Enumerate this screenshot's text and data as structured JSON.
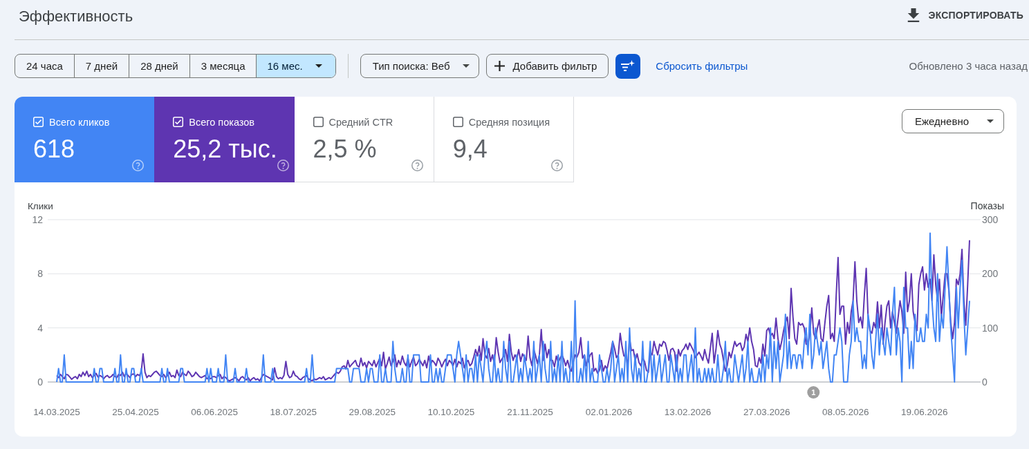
{
  "header": {
    "title": "Эффективность",
    "export_button": {
      "label": "ЭКСПОРТИРОВАТЬ"
    }
  },
  "filters": {
    "date_ranges": [
      {
        "label": "24 часа",
        "selected": false,
        "kind": "preset"
      },
      {
        "label": "7 дней",
        "selected": false,
        "kind": "preset"
      },
      {
        "label": "28 дней",
        "selected": false,
        "kind": "preset"
      },
      {
        "label": "3 месяца",
        "selected": false,
        "kind": "preset"
      },
      {
        "label": "16 мес.",
        "selected": true,
        "kind": "menu"
      }
    ],
    "search_type": {
      "label": "Тип поиска: Веб"
    },
    "add_filter": {
      "label": "Добавить фильтр"
    },
    "reset_link": {
      "label": "Сбросить фильтры"
    },
    "updated": "Обновлено 3 часа назад"
  },
  "metrics": [
    {
      "label": "Всего кликов",
      "value": "618",
      "checked": true,
      "color": "#4285f4"
    },
    {
      "label": "Всего показов",
      "value": "25,2 тыс.",
      "checked": true,
      "color": "#5e35b1"
    },
    {
      "label": "Средний CTR",
      "value": "2,5 %",
      "checked": false
    },
    {
      "label": "Средняя позиция",
      "value": "9,4",
      "checked": false
    }
  ],
  "granularity": {
    "value": "Ежедневно"
  },
  "chart": {
    "chart_data": {
      "type": "line",
      "ylabel": "Клики",
      "y2label": "Показы",
      "ylim": [
        0,
        12
      ],
      "yticks": [
        0,
        4,
        8,
        12
      ],
      "y2lim": [
        0,
        300
      ],
      "y2ticks": [
        0,
        100,
        200,
        300
      ],
      "categories": [
        "14.03.2025",
        null,
        null,
        null,
        null,
        null,
        null,
        null,
        null,
        null,
        null,
        null,
        null,
        null,
        null,
        null,
        null,
        null,
        null,
        null,
        null,
        null,
        null,
        null,
        null,
        null,
        null,
        null,
        null,
        null,
        null,
        null,
        null,
        null,
        null,
        null,
        null,
        null,
        null,
        null,
        null,
        null,
        "25.04.2025",
        null,
        null,
        null,
        null,
        null,
        null,
        null,
        null,
        null,
        null,
        null,
        null,
        null,
        null,
        null,
        null,
        null,
        null,
        null,
        null,
        null,
        null,
        null,
        null,
        null,
        null,
        null,
        null,
        null,
        null,
        null,
        null,
        null,
        null,
        null,
        null,
        null,
        null,
        null,
        null,
        null,
        "06.06.2025",
        null,
        null,
        null,
        null,
        null,
        null,
        null,
        null,
        null,
        null,
        null,
        null,
        null,
        null,
        null,
        null,
        null,
        null,
        null,
        null,
        null,
        null,
        null,
        null,
        null,
        null,
        null,
        null,
        null,
        null,
        null,
        null,
        null,
        null,
        null,
        null,
        null,
        null,
        null,
        null,
        null,
        "18.07.2025",
        null,
        null,
        null,
        null,
        null,
        null,
        null,
        null,
        null,
        null,
        null,
        null,
        null,
        null,
        null,
        null,
        null,
        null,
        null,
        null,
        null,
        null,
        null,
        null,
        null,
        null,
        null,
        null,
        null,
        null,
        null,
        null,
        null,
        null,
        null,
        null,
        null,
        null,
        null,
        null,
        null,
        "29.08.2025",
        null,
        null,
        null,
        null,
        null,
        null,
        null,
        null,
        null,
        null,
        null,
        null,
        null,
        null,
        null,
        null,
        null,
        null,
        null,
        null,
        null,
        null,
        null,
        null,
        null,
        null,
        null,
        null,
        null,
        null,
        null,
        null,
        null,
        null,
        null,
        null,
        null,
        null,
        null,
        null,
        null,
        "10.10.2025",
        null,
        null,
        null,
        null,
        null,
        null,
        null,
        null,
        null,
        null,
        null,
        null,
        null,
        null,
        null,
        null,
        null,
        null,
        null,
        null,
        null,
        null,
        null,
        null,
        null,
        null,
        null,
        null,
        null,
        null,
        null,
        null,
        null,
        null,
        null,
        null,
        null,
        null,
        null,
        null,
        null,
        "21.11.2025",
        null,
        null,
        null,
        null,
        null,
        null,
        null,
        null,
        null,
        null,
        null,
        null,
        null,
        null,
        null,
        null,
        null,
        null,
        null,
        null,
        null,
        null,
        null,
        null,
        null,
        null,
        null,
        null,
        null,
        null,
        null,
        null,
        null,
        null,
        null,
        null,
        null,
        null,
        null,
        null,
        null,
        "02.01.2026",
        null,
        null,
        null,
        null,
        null,
        null,
        null,
        null,
        null,
        null,
        null,
        null,
        null,
        null,
        null,
        null,
        null,
        null,
        null,
        null,
        null,
        null,
        null,
        null,
        null,
        null,
        null,
        null,
        null,
        null,
        null,
        null,
        null,
        null,
        null,
        null,
        null,
        null,
        null,
        null,
        null,
        "13.02.2026",
        null,
        null,
        null,
        null,
        null,
        null,
        null,
        null,
        null,
        null,
        null,
        null,
        null,
        null,
        null,
        null,
        null,
        null,
        null,
        null,
        null,
        null,
        null,
        null,
        null,
        null,
        null,
        null,
        null,
        null,
        null,
        null,
        null,
        null,
        null,
        null,
        null,
        null,
        null,
        null,
        null,
        "27.03.2026",
        null,
        null,
        null,
        null,
        null,
        null,
        null,
        null,
        null,
        null,
        null,
        null,
        null,
        null,
        null,
        null,
        null,
        null,
        null,
        null,
        null,
        null,
        null,
        null,
        null,
        null,
        null,
        null,
        null,
        null,
        null,
        null,
        null,
        null,
        null,
        null,
        null,
        null,
        null,
        null,
        null,
        "08.05.2026",
        null,
        null,
        null,
        null,
        null,
        null,
        null,
        null,
        null,
        null,
        null,
        null,
        null,
        null,
        null,
        null,
        null,
        null,
        null,
        null,
        null,
        null,
        null,
        null,
        null,
        null,
        null,
        null,
        null,
        null,
        null,
        null,
        null,
        null,
        null,
        null,
        null,
        null,
        null,
        null,
        null,
        "19.06.2026",
        null,
        null,
        null,
        null,
        null,
        null,
        null,
        null,
        null,
        null,
        null,
        null,
        null,
        null,
        null,
        null,
        null,
        null,
        null,
        null,
        null,
        null,
        null,
        null
      ],
      "annotations": [
        "1"
      ],
      "series": [
        {
          "color": "#4285f4",
          "values": [
            0,
            1,
            0,
            0,
            2,
            0,
            0,
            0,
            0,
            0,
            0,
            0,
            0,
            0,
            0,
            0,
            0,
            0,
            0,
            0,
            1,
            0,
            0,
            1,
            1,
            0,
            0,
            0,
            0,
            0,
            0,
            1,
            0,
            0,
            2,
            0,
            0,
            1,
            0,
            0,
            1,
            1,
            0,
            0,
            0,
            1,
            0,
            0,
            0,
            0,
            0,
            0,
            0,
            0,
            0,
            0,
            1,
            0,
            0,
            1,
            0,
            0,
            0,
            0,
            0,
            0,
            1,
            1,
            0,
            0,
            0,
            0,
            0,
            0,
            0,
            0,
            0,
            0,
            0,
            0,
            1,
            0,
            1,
            0,
            0,
            0,
            1,
            0,
            0,
            0,
            2,
            0,
            0,
            0,
            0,
            1,
            0,
            0,
            0,
            0,
            0,
            1,
            0,
            0,
            0,
            0,
            0,
            0,
            0,
            0,
            2,
            0,
            0,
            0,
            0,
            1,
            0,
            0,
            0,
            0,
            0,
            0,
            0,
            0,
            0,
            0,
            0,
            0,
            0,
            0,
            0,
            0,
            0,
            1,
            0,
            0,
            2,
            0,
            0,
            0,
            0,
            0,
            0,
            0,
            0,
            0,
            0,
            0,
            0,
            1,
            1,
            1,
            1,
            1,
            1,
            1,
            0,
            0,
            1,
            1,
            1,
            1,
            0,
            0,
            0,
            1,
            0,
            1,
            1,
            0,
            0,
            0,
            2,
            0,
            0,
            1,
            0,
            0,
            0,
            3,
            1,
            0,
            0,
            0,
            1,
            0,
            0,
            2,
            0,
            0,
            2,
            2,
            2,
            2,
            0,
            0,
            0,
            0,
            0,
            2,
            0,
            0,
            1,
            0,
            1,
            0,
            0,
            1,
            2,
            2,
            2,
            1,
            0,
            2,
            3,
            2,
            1,
            0,
            2,
            0,
            1,
            1,
            0,
            2,
            0,
            2,
            1,
            0,
            2,
            3,
            1,
            0,
            0,
            2,
            0,
            1,
            0,
            0,
            3,
            1,
            0,
            3,
            0,
            0,
            1,
            2,
            0,
            1,
            0,
            2,
            1,
            0,
            1,
            0,
            3,
            0,
            1,
            2,
            0,
            3,
            1,
            0,
            0,
            3,
            0,
            1,
            0,
            2,
            0,
            3,
            0,
            1,
            0,
            0,
            3,
            0,
            6,
            0,
            0,
            1,
            0,
            2,
            0,
            3,
            0,
            1,
            0,
            0,
            0,
            2,
            1,
            0,
            0,
            1,
            0,
            1,
            3,
            0,
            1,
            2,
            0,
            1,
            0,
            3,
            0,
            4,
            1,
            0,
            2,
            0,
            1,
            0,
            3,
            0,
            0,
            1,
            3,
            0,
            2,
            0,
            1,
            2,
            0,
            1,
            2,
            0,
            0,
            2,
            1,
            0,
            2,
            0,
            1,
            0,
            2,
            2,
            0,
            1,
            2,
            0,
            4,
            0,
            1,
            0,
            0,
            1,
            0,
            1,
            0,
            1,
            0,
            0,
            2,
            0,
            0,
            1,
            3,
            0,
            1,
            0,
            0,
            2,
            1,
            0,
            1,
            2,
            0,
            1,
            3,
            0,
            1,
            0,
            0,
            0,
            1,
            0,
            2,
            0,
            2,
            1,
            4,
            0,
            3,
            1,
            3,
            0,
            1,
            2,
            5,
            1,
            3,
            1,
            2,
            2,
            1,
            2,
            2,
            1,
            3,
            4,
            2,
            5,
            1,
            2,
            4,
            3,
            2,
            3,
            1,
            2,
            3,
            1,
            0,
            0,
            2,
            2,
            3,
            4,
            3,
            0,
            0,
            0,
            2,
            3,
            6,
            3,
            4,
            3,
            3,
            1,
            2,
            1,
            5,
            4,
            2,
            1,
            3,
            5,
            2,
            4,
            3,
            2,
            4,
            3,
            2,
            5,
            7,
            2,
            4,
            3,
            0,
            7,
            4,
            4,
            1,
            3,
            1,
            5,
            3,
            3,
            4,
            3,
            3,
            5,
            4,
            11,
            6,
            4,
            3,
            8,
            3,
            5,
            4,
            7,
            10,
            7,
            4,
            2,
            0,
            7,
            4,
            7,
            9,
            5,
            2,
            4,
            6
          ]
        },
        {
          "color": "#5e35b1",
          "axis": "y2",
          "values": [
            12,
            8,
            14,
            10,
            6,
            14,
            13,
            9,
            5,
            8,
            10,
            6,
            14,
            10,
            18,
            12,
            20,
            10,
            14,
            8,
            12,
            16,
            9,
            12,
            10,
            6,
            10,
            12,
            8,
            10,
            14,
            10,
            8,
            14,
            12,
            18,
            10,
            16,
            12,
            8,
            14,
            15,
            10,
            14,
            12,
            18,
            52,
            18,
            8,
            12,
            10,
            14,
            18,
            20,
            16,
            12,
            10,
            14,
            8,
            12,
            18,
            10,
            12,
            8,
            22,
            12,
            10,
            18,
            14,
            12,
            20,
            16,
            10,
            12,
            18,
            14,
            10,
            8,
            10,
            12,
            6,
            8,
            6,
            10,
            10,
            8,
            12,
            14,
            6,
            10,
            8,
            4,
            2,
            4,
            6,
            8,
            6,
            2,
            8,
            10,
            6,
            4,
            8,
            2,
            6,
            8,
            4,
            6,
            2,
            8,
            14,
            12,
            10,
            8,
            6,
            4,
            26,
            10,
            6,
            8,
            6,
            12,
            38,
            14,
            8,
            10,
            20,
            12,
            10,
            6,
            4,
            8,
            10,
            12,
            6,
            4,
            2,
            6,
            4,
            6,
            8,
            6,
            10,
            4,
            6,
            8,
            6,
            10,
            14,
            18,
            16,
            20,
            28,
            30,
            24,
            40,
            28,
            32,
            36,
            40,
            30,
            28,
            44,
            30,
            36,
            26,
            38,
            34,
            30,
            40,
            28,
            36,
            44,
            30,
            55,
            24,
            34,
            46,
            30,
            38,
            50,
            28,
            40,
            32,
            48,
            36,
            30,
            44,
            28,
            38,
            46,
            30,
            34,
            42,
            36,
            30,
            40,
            26,
            48,
            32,
            40,
            36,
            30,
            44,
            38,
            28,
            36,
            42,
            30,
            40,
            36,
            30,
            42,
            28,
            38,
            34,
            44,
            26,
            36,
            40,
            30,
            34,
            46,
            60,
            48,
            66,
            40,
            80,
            50,
            44,
            62,
            38,
            50,
            34,
            82,
            56,
            36,
            42,
            48,
            60,
            38,
            88,
            56,
            40,
            50,
            44,
            60,
            38,
            52,
            46,
            40,
            85,
            45,
            30,
            60,
            48,
            34,
            50,
            97,
            40,
            70,
            45,
            60,
            40,
            40,
            28,
            48,
            36,
            44,
            50,
            42,
            30,
            40,
            26,
            20,
            36,
            50,
            46,
            55,
            82,
            44,
            50,
            30,
            40,
            50,
            54,
            20,
            25,
            16,
            22,
            40,
            20,
            30,
            24,
            40,
            55,
            75,
            62,
            45,
            50,
            90,
            66,
            48,
            50,
            30,
            80,
            58,
            60,
            40,
            52,
            36,
            30,
            44,
            38,
            22,
            18,
            55,
            50,
            75,
            62,
            50,
            70,
            66,
            75,
            72,
            58,
            40,
            60,
            62,
            55,
            20,
            60,
            48,
            58,
            62,
            70,
            60,
            72,
            65,
            58,
            45,
            50,
            55,
            48,
            40,
            60,
            45,
            35,
            62,
            90,
            35,
            60,
            95,
            70,
            60,
            40,
            20,
            30,
            55,
            45,
            60,
            75,
            66,
            70,
            72,
            58,
            65,
            88,
            75,
            100,
            75,
            60,
            30,
            28,
            45,
            35,
            70,
            48,
            95,
            100,
            85,
            90,
            80,
            118,
            80,
            60,
            75,
            95,
            110,
            120,
            80,
            173,
            120,
            80,
            70,
            110,
            105,
            108,
            100,
            70,
            70,
            90,
            137,
            90,
            80,
            100,
            115,
            80,
            75,
            110,
            140,
            160,
            80,
            90,
            75,
            160,
            230,
            125,
            140,
            140,
            70,
            110,
            90,
            130,
            150,
            222,
            150,
            110,
            120,
            100,
            160,
            210,
            120,
            95,
            90,
            110,
            100,
            148,
            100,
            142,
            70,
            110,
            140,
            150,
            100,
            130,
            110,
            90,
            120,
            150,
            130,
            90,
            203,
            130,
            150,
            200,
            130,
            110,
            95,
            180,
            200,
            213,
            170,
            200,
            175,
            190,
            150,
            235,
            180,
            150,
            190,
            120,
            160,
            200,
            200,
            170,
            110,
            80,
            110,
            190,
            180,
            200,
            245,
            150,
            105,
            180,
            262
          ]
        }
      ]
    }
  }
}
